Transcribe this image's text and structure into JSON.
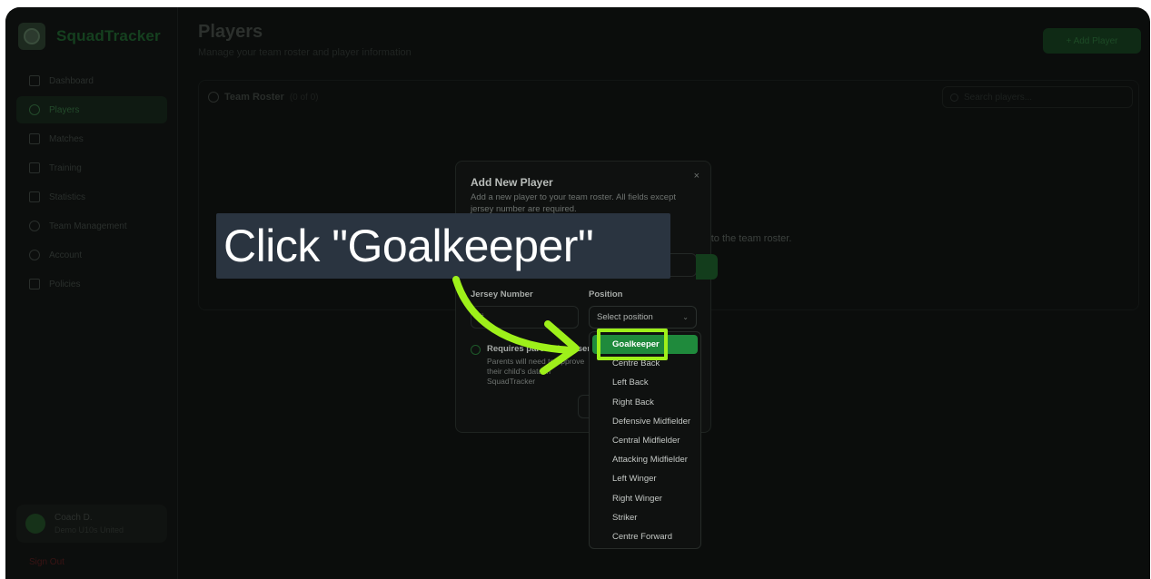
{
  "app": {
    "brand": "SquadTracker",
    "brand_icon": "soccer-ball-icon",
    "accent": "#1f8a3c",
    "highlight": "#9ef01a"
  },
  "sidebar": {
    "items": [
      {
        "label": "Dashboard",
        "icon": "home-icon"
      },
      {
        "label": "Players",
        "icon": "users-icon",
        "active": true
      },
      {
        "label": "Matches",
        "icon": "trophy-icon"
      },
      {
        "label": "Training",
        "icon": "training-icon"
      },
      {
        "label": "Statistics",
        "icon": "bar-chart-icon"
      },
      {
        "label": "Team Management",
        "icon": "team-icon"
      },
      {
        "label": "Account",
        "icon": "user-icon"
      },
      {
        "label": "Policies",
        "icon": "document-icon"
      }
    ],
    "user": {
      "name": "Coach D.",
      "team": "Demo U10s United"
    },
    "sign_out": "Sign Out"
  },
  "main": {
    "title": "Players",
    "subtitle": "Manage your team roster and player information",
    "add_button": "+ Add Player",
    "roster_title": "Team Roster",
    "roster_count": "(0 of 0)",
    "search_placeholder": "Search players...",
    "empty_fragment": "r to the team roster."
  },
  "modal": {
    "title": "Add New Player",
    "description": "Add a new player to your team roster. All fields except jersey number are required.",
    "close": "×",
    "jersey_label": "Jersey Number",
    "jersey_value": "#",
    "position_label": "Position",
    "position_placeholder": "Select position",
    "consent_title": "Requires parental consent",
    "consent_desc": "Parents will need to approve their child's data in SquadTracker"
  },
  "dropdown": {
    "options": [
      "Goalkeeper",
      "Centre Back",
      "Left Back",
      "Right Back",
      "Defensive Midfielder",
      "Central Midfielder",
      "Attacking Midfielder",
      "Left Winger",
      "Right Winger",
      "Striker",
      "Centre Forward"
    ],
    "selected": "Goalkeeper"
  },
  "annotation": {
    "callout_text": "Click \"Goalkeeper\""
  }
}
